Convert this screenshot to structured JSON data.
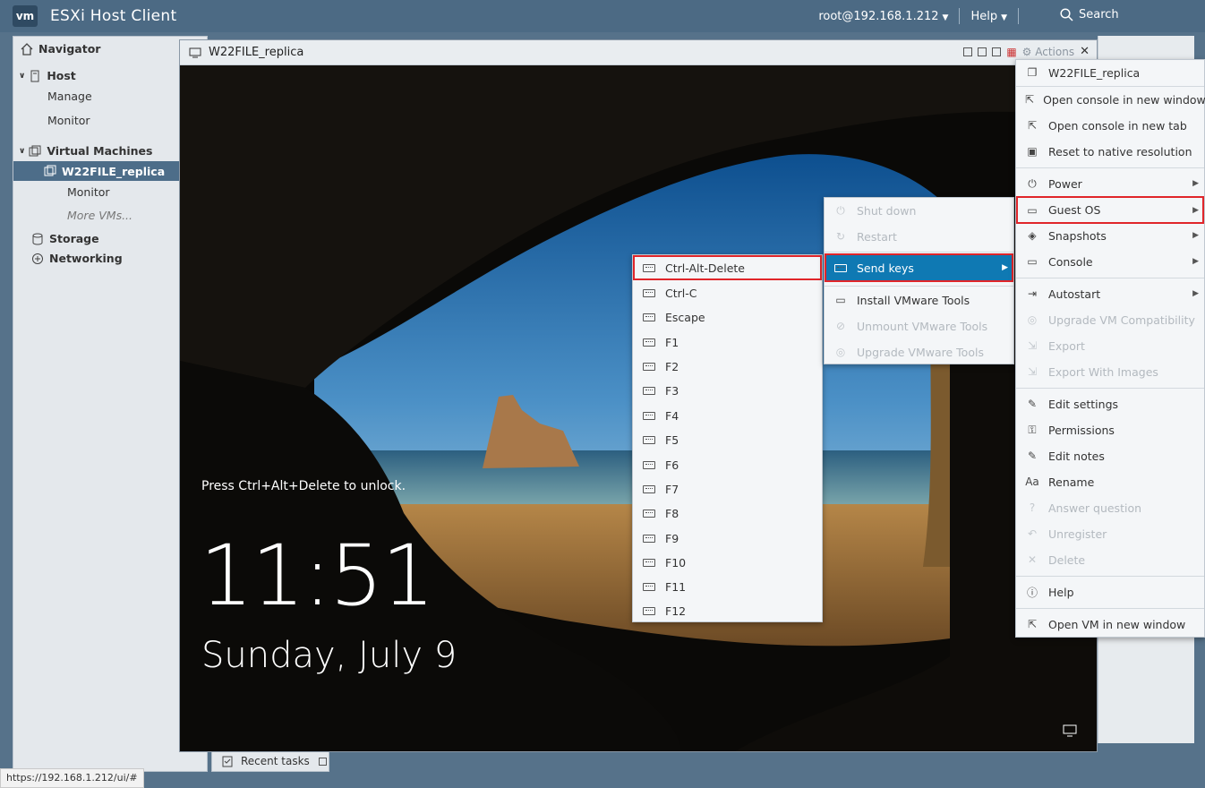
{
  "app": {
    "logo": "vm",
    "title": "ESXi Host Client"
  },
  "topbar": {
    "user": "root@192.168.1.212",
    "help": "Help",
    "search": "Search"
  },
  "navigator": {
    "title": "Navigator",
    "host": "Host",
    "manage": "Manage",
    "monitor": "Monitor",
    "vms": "Virtual Machines",
    "vm_selected": "W22FILE_replica",
    "vm_monitor": "Monitor",
    "more_vms": "More VMs...",
    "storage": "Storage",
    "networking": "Networking"
  },
  "recent_tasks": "Recent tasks",
  "console": {
    "title": "W22FILE_replica",
    "actions": "Actions",
    "lock_message": "Press Ctrl+Alt+Delete to unlock.",
    "time": "11:51",
    "date": "Sunday, July 9"
  },
  "actions_menu": {
    "header": "W22FILE_replica",
    "items": [
      "Open console in new window",
      "Open console in new tab",
      "Reset to native resolution",
      "Power",
      "Guest OS",
      "Snapshots",
      "Console",
      "Autostart",
      "Upgrade VM Compatibility",
      "Export",
      "Export With Images",
      "Edit settings",
      "Permissions",
      "Edit notes",
      "Rename",
      "Answer question",
      "Unregister",
      "Delete",
      "Help",
      "Open VM in new window"
    ]
  },
  "guestos_menu": {
    "items": [
      "Shut down",
      "Restart",
      "Send keys",
      "Install VMware Tools",
      "Unmount VMware Tools",
      "Upgrade VMware Tools"
    ]
  },
  "sendkeys_menu": {
    "items": [
      "Ctrl-Alt-Delete",
      "Ctrl-C",
      "Escape",
      "F1",
      "F2",
      "F3",
      "F4",
      "F5",
      "F6",
      "F7",
      "F8",
      "F9",
      "F10",
      "F11",
      "F12"
    ]
  },
  "status_url": "https://192.168.1.212/ui/#",
  "colors": {
    "accent": "#0f79b3",
    "highlight_box": "#e0252a",
    "topbar": "#4c6a84"
  }
}
